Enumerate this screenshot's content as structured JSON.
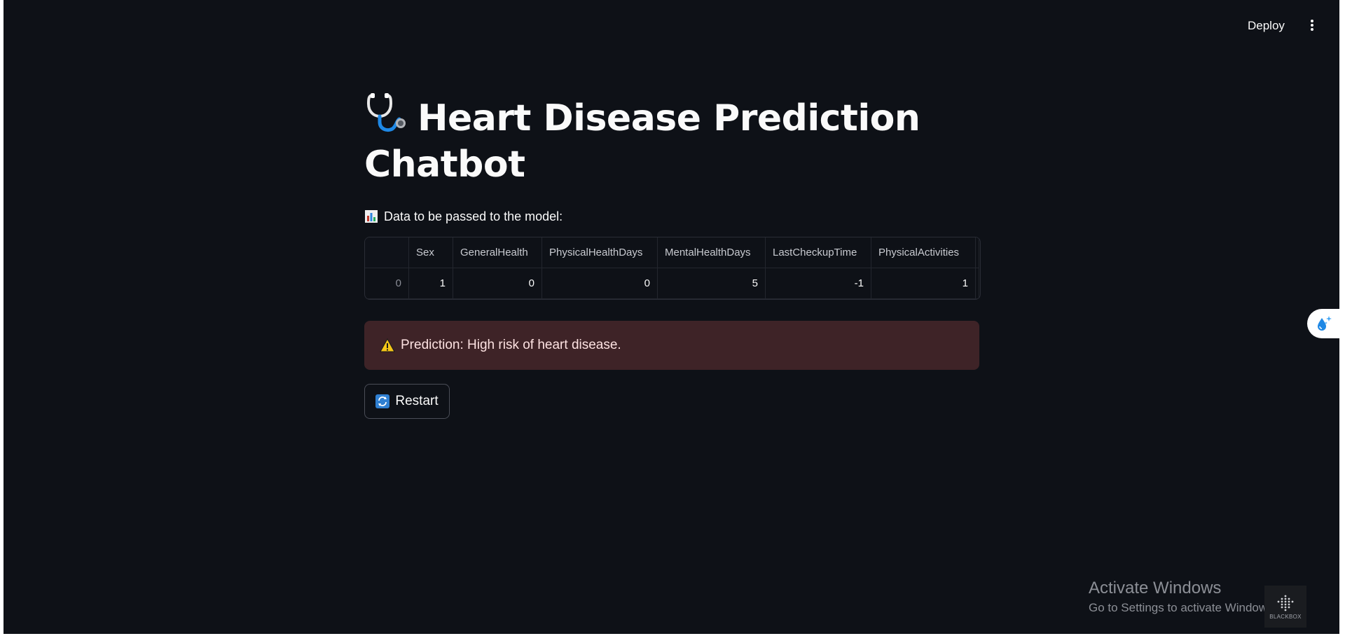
{
  "header": {
    "deploy_label": "Deploy",
    "menu_icon": "kebab-menu-icon"
  },
  "main": {
    "title_icon": "stethoscope-icon",
    "title_line1": "Heart Disease Prediction",
    "title_line2": "Chatbot",
    "data_heading_icon": "bar-chart-icon",
    "data_heading": "Data to be passed to the model:",
    "table": {
      "columns": [
        "",
        "Sex",
        "GeneralHealth",
        "PhysicalHealthDays",
        "MentalHealthDays",
        "LastCheckupTime",
        "PhysicalActivities"
      ],
      "rows": [
        [
          "0",
          "1",
          "0",
          "0",
          "5",
          "-1",
          "1"
        ]
      ]
    },
    "alert": {
      "icon": "warning-icon",
      "text": "Prediction: High risk of heart disease."
    },
    "restart": {
      "icon": "refresh-icon",
      "label": "Restart"
    }
  },
  "side_widget": {
    "icon": "water-drop-sparkle-icon"
  },
  "watermark": {
    "title": "Activate Windows",
    "subtitle": "Go to Settings to activate Windows."
  },
  "logo": {
    "text": "BLACKBOX"
  },
  "colors": {
    "background": "#0e1117",
    "text": "#fafafa",
    "alert_bg": "#3e2327",
    "accent_blue": "#1e88e5"
  }
}
